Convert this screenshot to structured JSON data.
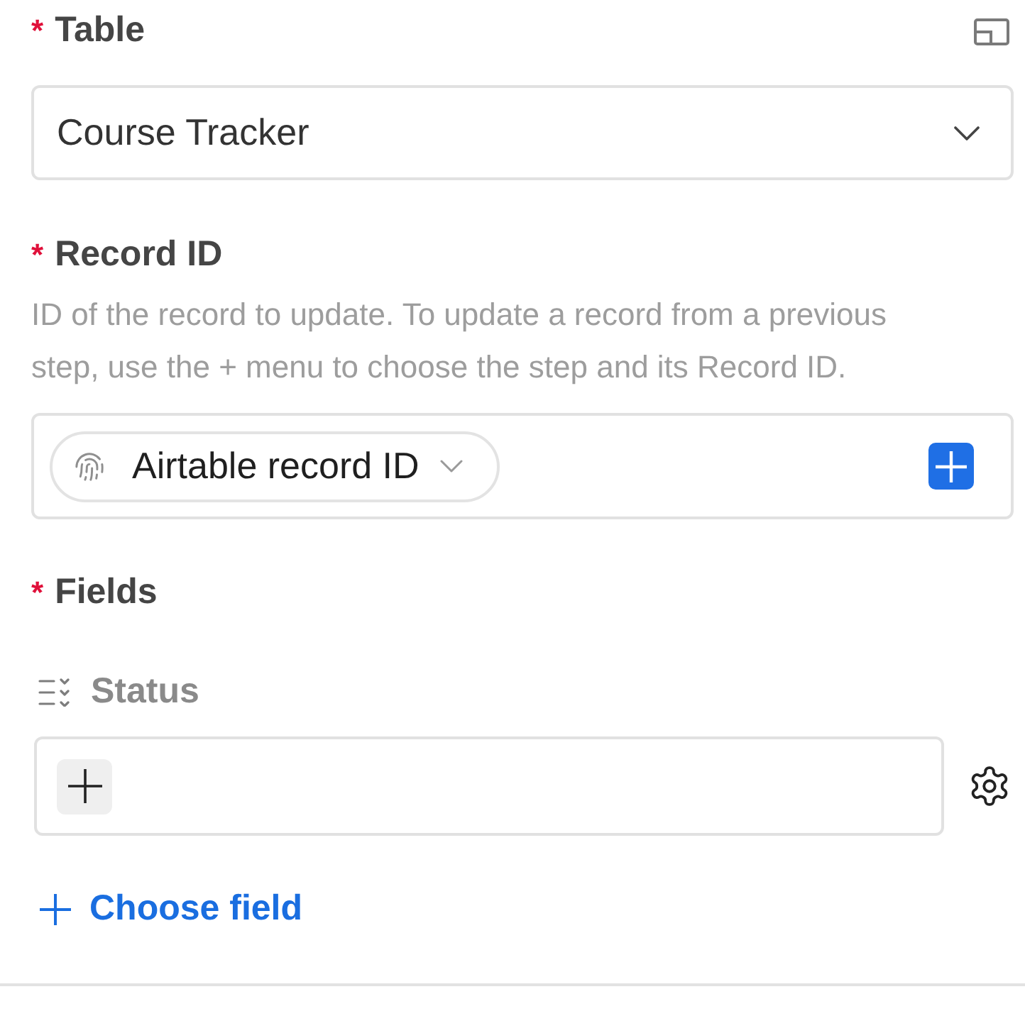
{
  "table": {
    "required_mark": "*",
    "label": "Table",
    "value": "Course Tracker"
  },
  "record_id": {
    "required_mark": "*",
    "label": "Record ID",
    "description": "ID of the record to update. To update a record from a previous step, use the + menu to choose the step and its Record ID.",
    "token": "Airtable record ID"
  },
  "fields": {
    "required_mark": "*",
    "label": "Fields",
    "items": [
      {
        "name": "Status"
      }
    ],
    "add_link": "Choose field"
  }
}
